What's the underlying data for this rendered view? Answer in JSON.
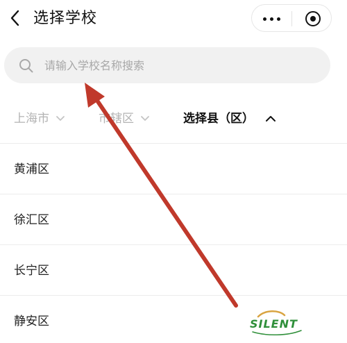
{
  "header": {
    "title": "选择学校"
  },
  "search": {
    "placeholder": "请输入学校名称搜索"
  },
  "filters": [
    {
      "label": "上海市",
      "state": "collapsed"
    },
    {
      "label": "市辖区",
      "state": "collapsed"
    },
    {
      "label": "选择县（区）",
      "state": "expanded"
    }
  ],
  "districts": [
    "黄浦区",
    "徐汇区",
    "长宁区",
    "静安区"
  ],
  "watermark": {
    "text": "SILENT"
  },
  "colors": {
    "annotation_arrow": "#c0392b",
    "search_bg": "#f1f1f1",
    "inactive_filter": "#b3b3b3",
    "logo_green": "#2f8f3a"
  },
  "icons": {
    "back": "chevron-left-icon",
    "more": "more-dots-icon",
    "close": "record-circle-icon",
    "search": "search-icon",
    "dropdown": "chevron-down-icon",
    "collapse": "chevron-up-icon"
  }
}
